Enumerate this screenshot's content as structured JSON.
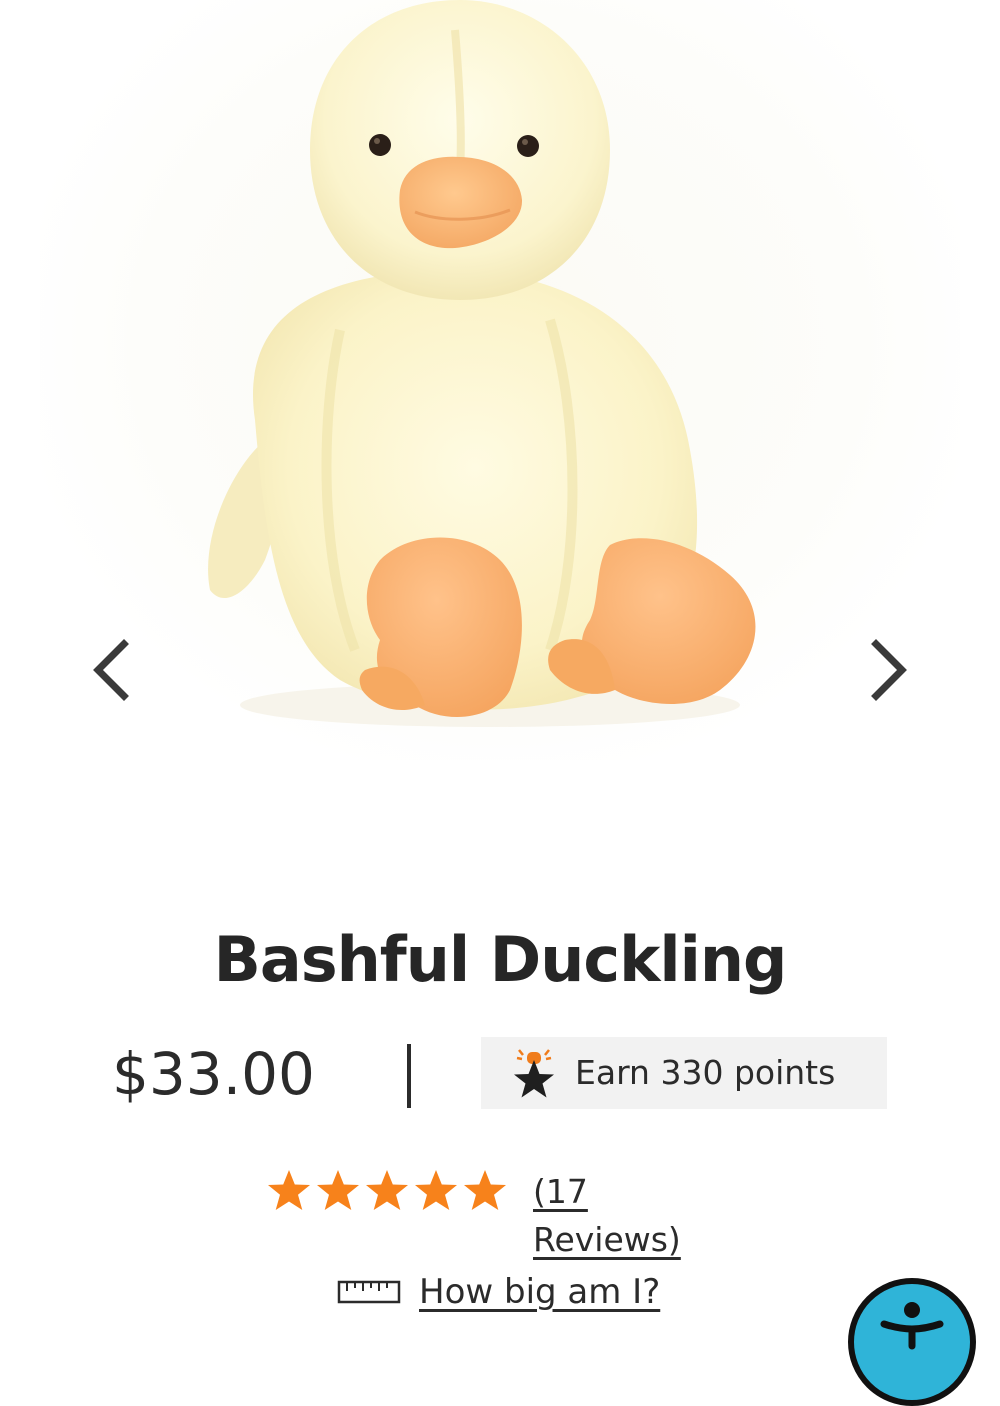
{
  "product": {
    "title": "Bashful Duckling",
    "price": "$33.00",
    "separator": "|",
    "image_alt": "Bashful Duckling plush toy",
    "image_index": 1
  },
  "rewards": {
    "label": "Earn 330 points",
    "icon": "rewards-star-icon",
    "accent": "#f07c1b"
  },
  "rating": {
    "stars": 5,
    "max_stars": 5,
    "reviews_label": "(17 Reviews)",
    "star_color": "#f7821b"
  },
  "size_guide": {
    "label": "How big am I?",
    "icon": "ruler-icon"
  },
  "gallery": {
    "prev_icon": "chevron-left-icon",
    "next_icon": "chevron-right-icon"
  },
  "accessibility": {
    "icon": "accessibility-icon",
    "color": "#2fb4d8"
  }
}
